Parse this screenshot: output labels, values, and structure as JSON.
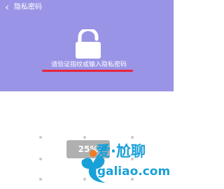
{
  "nav": {
    "back_icon": "‹",
    "title": "隐私密码"
  },
  "lock": {
    "icon": "lock-open-icon",
    "color": "#ffffff"
  },
  "prompt": {
    "text": "请验证指纹或输入隐私密码",
    "underline_color": "#e8243c"
  },
  "colors": {
    "header_bg": "#9a94e6",
    "body_bg": "#ffffff",
    "watermark": "#1aa0d8"
  },
  "pattern": {
    "hint_text": "25%"
  },
  "watermark": {
    "brand": "爱·尬聊",
    "url": "igaliao.com"
  }
}
